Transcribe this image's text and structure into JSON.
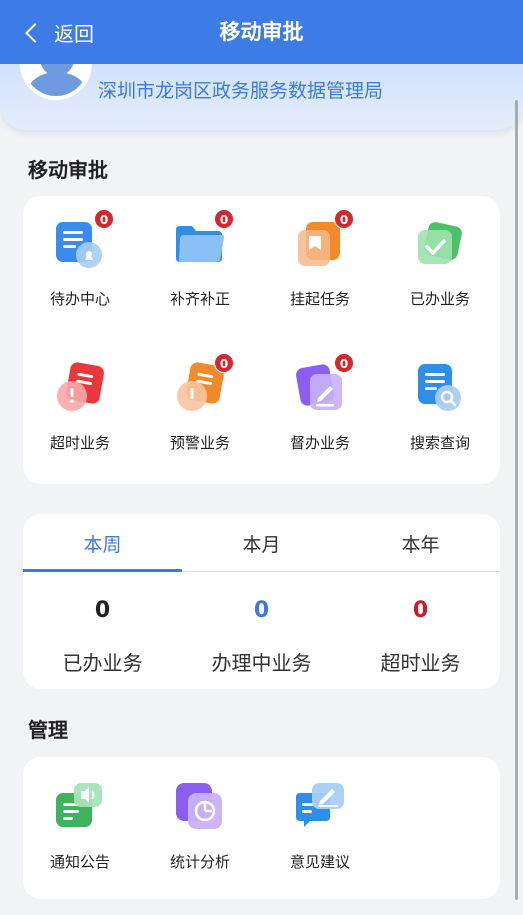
{
  "header": {
    "back_label": "返回",
    "title": "移动审批"
  },
  "profile": {
    "org": "深圳市龙岗区政务服务数据管理局"
  },
  "approval": {
    "section_title": "移动审批",
    "items": [
      {
        "label": "待办中心",
        "badge": "0",
        "icon": "pending-icon"
      },
      {
        "label": "补齐补正",
        "badge": "0",
        "icon": "folder-icon"
      },
      {
        "label": "挂起任务",
        "badge": "0",
        "icon": "bookmark-icon"
      },
      {
        "label": "已办业务",
        "badge": "",
        "icon": "check-icon"
      },
      {
        "label": "超时业务",
        "badge": "",
        "icon": "overtime-icon"
      },
      {
        "label": "预警业务",
        "badge": "0",
        "icon": "warning-icon"
      },
      {
        "label": "督办业务",
        "badge": "0",
        "icon": "supervise-icon"
      },
      {
        "label": "搜索查询",
        "badge": "",
        "icon": "search-icon"
      }
    ]
  },
  "stats": {
    "tabs": [
      "本周",
      "本月",
      "本年"
    ],
    "active_tab": 0,
    "values": [
      {
        "value": "0",
        "label": "已办业务",
        "color": "#222222"
      },
      {
        "value": "0",
        "label": "办理中业务",
        "color": "#3b7ae0"
      },
      {
        "value": "0",
        "label": "超时业务",
        "color": "#c81e28"
      }
    ]
  },
  "manage": {
    "section_title": "管理",
    "items": [
      {
        "label": "通知公告",
        "icon": "notice-icon"
      },
      {
        "label": "统计分析",
        "icon": "statistics-icon"
      },
      {
        "label": "意见建议",
        "icon": "feedback-icon"
      }
    ]
  },
  "colors": {
    "primary": "#3d7be6",
    "badge": "#d9262e",
    "accent_blue": "#3b7ae0",
    "accent_red": "#c81e28"
  }
}
